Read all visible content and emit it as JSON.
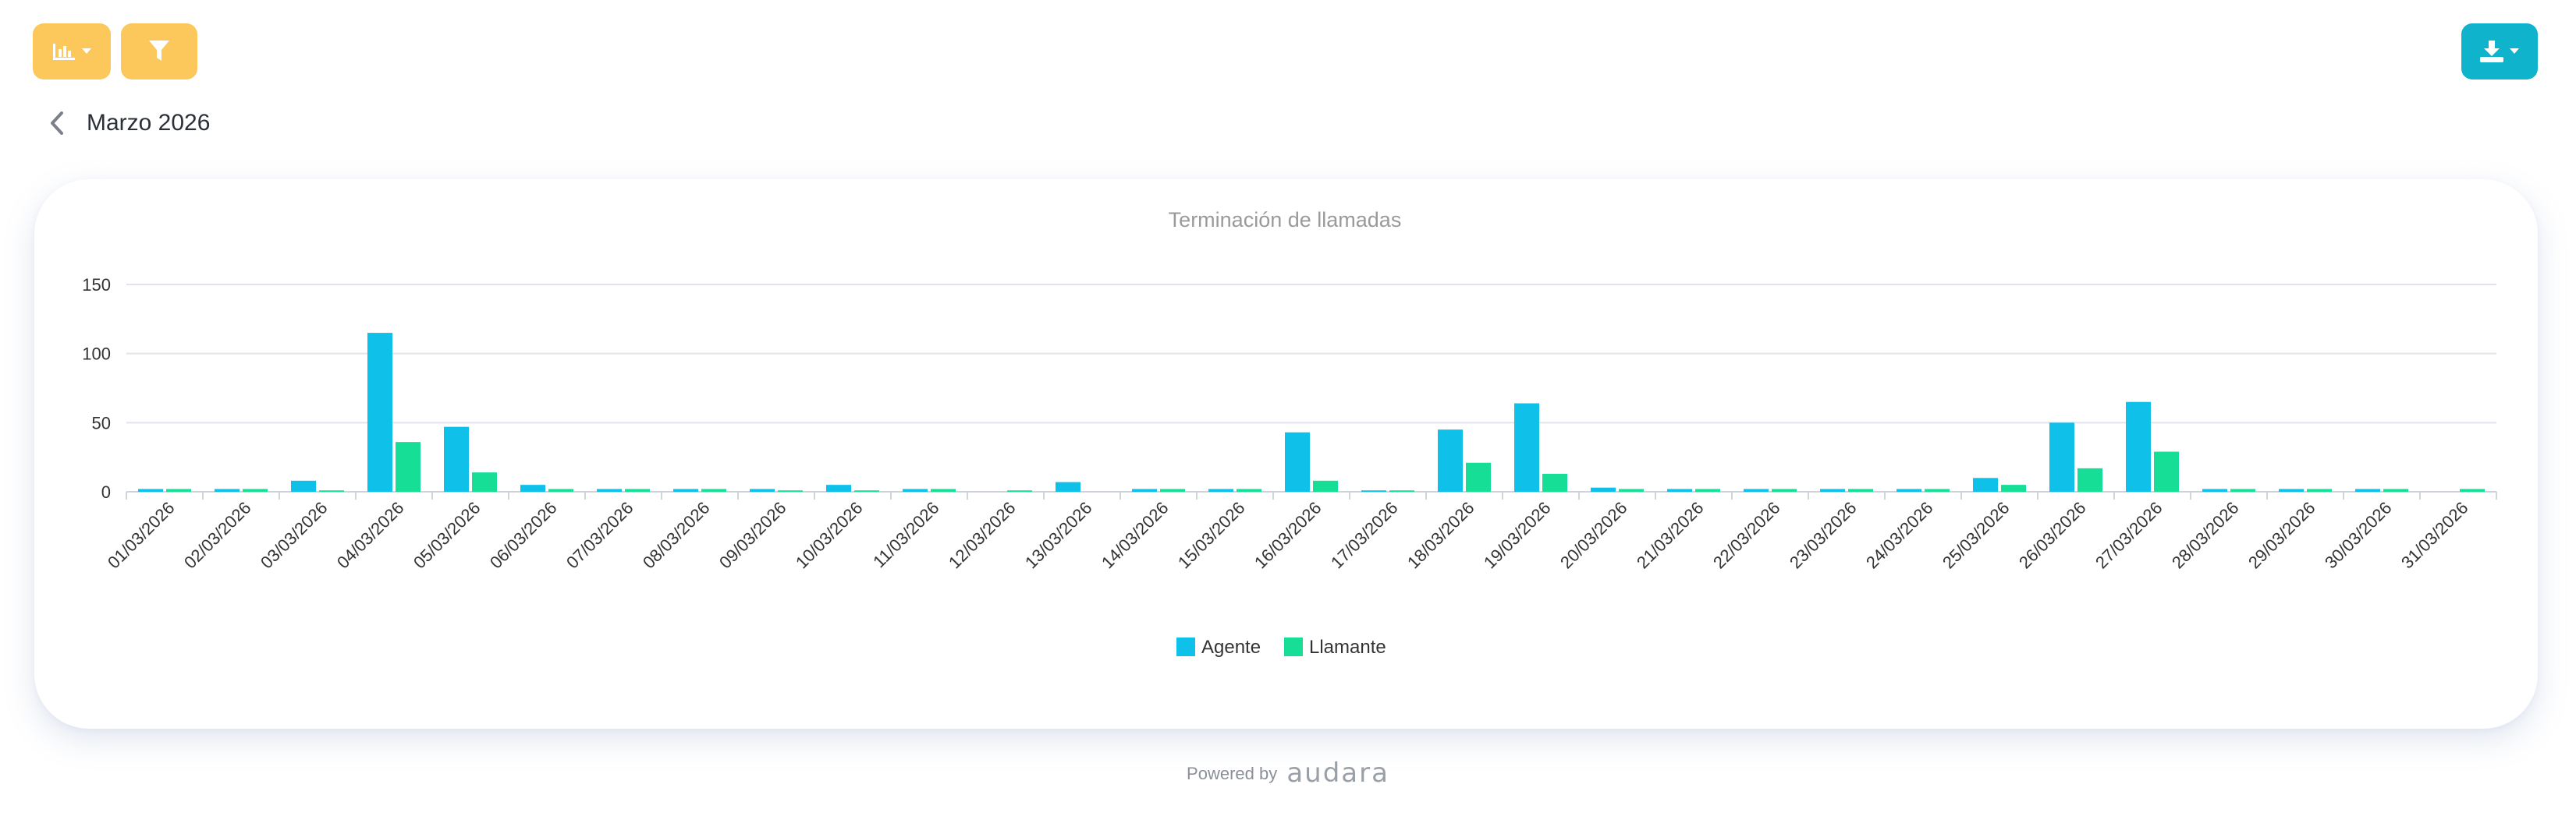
{
  "toolbar": {
    "chart_menu_icon": "bar-chart-icon",
    "filter_icon": "filter-icon",
    "download_icon": "download-icon",
    "accent_color": "#fcc75b",
    "download_color": "#10b3cc"
  },
  "period": {
    "title": "Marzo 2026",
    "back_icon": "chevron-left-icon"
  },
  "footer": {
    "powered_by": "Powered by",
    "brand": "audara"
  },
  "chart_data": {
    "type": "bar",
    "title": "Terminación de llamadas",
    "xlabel": "",
    "ylabel": "",
    "ylim": [
      0,
      150
    ],
    "yticks": [
      0,
      50,
      100,
      150
    ],
    "grid": true,
    "legend_position": "bottom-center",
    "categories": [
      "01/03/2026",
      "02/03/2026",
      "03/03/2026",
      "04/03/2026",
      "05/03/2026",
      "06/03/2026",
      "07/03/2026",
      "08/03/2026",
      "09/03/2026",
      "10/03/2026",
      "11/03/2026",
      "12/03/2026",
      "13/03/2026",
      "14/03/2026",
      "15/03/2026",
      "16/03/2026",
      "17/03/2026",
      "18/03/2026",
      "19/03/2026",
      "20/03/2026",
      "21/03/2026",
      "22/03/2026",
      "23/03/2026",
      "24/03/2026",
      "25/03/2026",
      "26/03/2026",
      "27/03/2026",
      "28/03/2026",
      "29/03/2026",
      "30/03/2026",
      "31/03/2026"
    ],
    "series": [
      {
        "name": "Agente",
        "color": "#0fc1e9",
        "values": [
          2,
          2,
          8,
          115,
          47,
          5,
          2,
          2,
          2,
          5,
          2,
          0,
          7,
          2,
          2,
          43,
          1,
          45,
          64,
          3,
          2,
          2,
          2,
          2,
          10,
          50,
          65,
          2,
          2,
          2,
          0
        ]
      },
      {
        "name": "Llamante",
        "color": "#16de96",
        "values": [
          2,
          2,
          1,
          36,
          14,
          2,
          2,
          2,
          1,
          1,
          2,
          1,
          0,
          2,
          2,
          8,
          1,
          21,
          13,
          2,
          2,
          2,
          2,
          2,
          5,
          17,
          29,
          2,
          2,
          2,
          2
        ]
      }
    ]
  }
}
